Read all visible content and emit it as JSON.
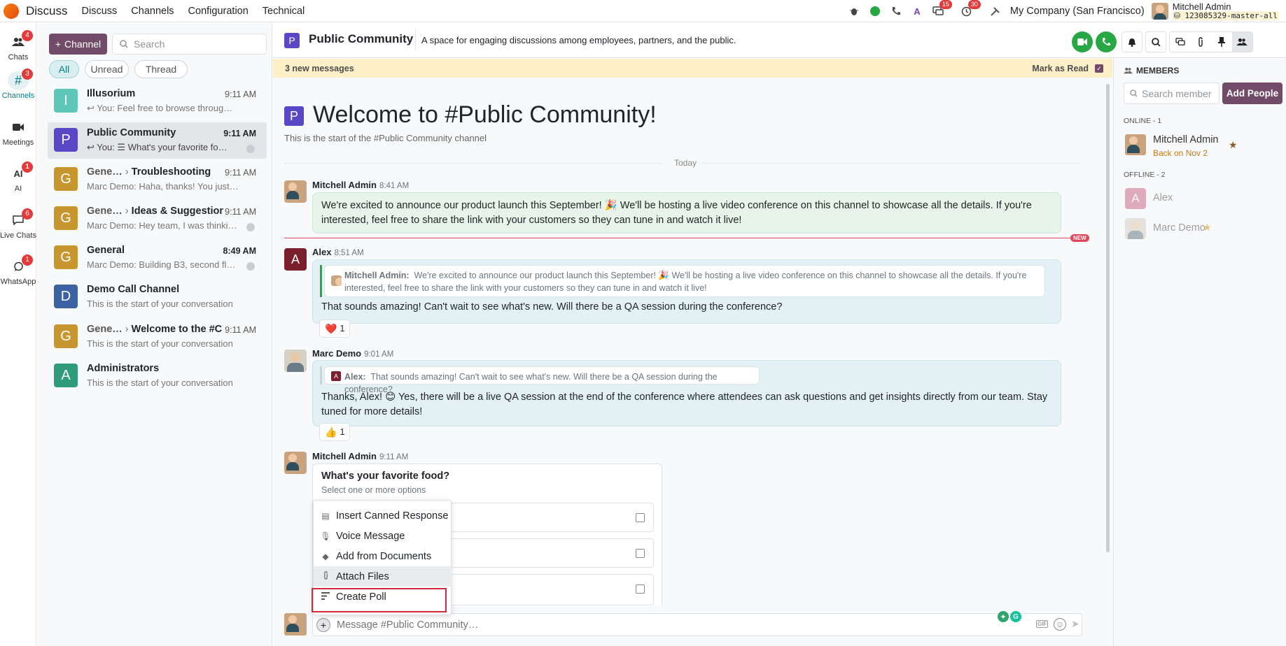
{
  "topbar": {
    "app_name": "Discuss",
    "menus": [
      "Discuss",
      "Channels",
      "Configuration",
      "Technical"
    ],
    "messages_badge": "15",
    "activity_badge": "30",
    "company": "My Company (San Francisco)",
    "user_name": "Mitchell Admin",
    "db_name": "123085329-master-all"
  },
  "rail": [
    {
      "label": "Chats",
      "badge": "4",
      "icon": "users-icon"
    },
    {
      "label": "Channels",
      "badge": "3",
      "icon": "hash-icon"
    },
    {
      "label": "Meetings",
      "badge": "",
      "icon": "video-icon"
    },
    {
      "label": "AI",
      "badge": "1",
      "icon": "ai-icon"
    },
    {
      "label": "Live Chats",
      "badge": "6",
      "icon": "chat-icon"
    },
    {
      "label": "WhatsApp",
      "badge": "1",
      "icon": "whatsapp-icon"
    }
  ],
  "sidebar": {
    "add_channel": "Channel",
    "search_placeholder": "Search",
    "filters": [
      "All",
      "Unread",
      "Thread"
    ],
    "conversations": [
      {
        "avatar": "I",
        "color": "#5fc7b8",
        "name": "Illusorium",
        "sub": "",
        "time": "9:11 AM",
        "preview": "↩ You: Feel free to browse throug…",
        "dot": false
      },
      {
        "avatar": "P",
        "color": "#5a47c5",
        "name": "Public Community",
        "sub": "",
        "time": "9:11 AM",
        "preview": "↩ You: ☰ What's your favorite fo…",
        "dot": true
      },
      {
        "avatar": "G",
        "color": "#c8962f",
        "name": "Gene…",
        "sub": "Troubleshooting",
        "time": "9:11 AM",
        "preview": "Marc Demo: Haha, thanks! You just…",
        "dot": false
      },
      {
        "avatar": "G",
        "color": "#c8962f",
        "name": "Gene…",
        "sub": "Ideas & Suggestions",
        "time": "9:11 AM",
        "preview": "Marc Demo: Hey team, I was thinki…",
        "dot": true
      },
      {
        "avatar": "G",
        "color": "#c8962f",
        "name": "General",
        "sub": "",
        "time": "8:49 AM",
        "preview": "Marc Demo: Building B3, second fl…",
        "dot": true
      },
      {
        "avatar": "D",
        "color": "#3b62a3",
        "name": "Demo Call Channel",
        "sub": "",
        "time": "",
        "preview": "This is the start of your conversation",
        "dot": false
      },
      {
        "avatar": "G",
        "color": "#c8962f",
        "name": "Gene…",
        "sub": "Welcome to the #C",
        "time": "9:11 AM",
        "preview": "This is the start of your conversation",
        "dot": false
      },
      {
        "avatar": "A",
        "color": "#2f9b7b",
        "name": "Administrators",
        "sub": "",
        "time": "",
        "preview": "This is the start of your conversation",
        "dot": false
      }
    ]
  },
  "header": {
    "channel_name": "Public Community",
    "description": "A space for engaging discussions among employees, partners, and the public."
  },
  "new_messages": {
    "text": "3 new messages",
    "mark_read": "Mark as Read"
  },
  "thread": {
    "welcome_title": "Welcome to #Public Community!",
    "welcome_sub": "This is the start of the #Public Community channel",
    "day_separator": "Today",
    "new_tag": "NEW",
    "messages": [
      {
        "author": "Mitchell Admin",
        "time": "8:41 AM",
        "text": "We're excited to announce our product launch this September! 🎉 We'll be hosting a live video conference on this channel to showcase all the details. If you're interested, feel free to share the link with your customers so they can tune in and watch it live!"
      },
      {
        "author": "Alex",
        "time": "8:51 AM",
        "quote_author": "Mitchell Admin:",
        "quote_text": "We're excited to announce our product launch this September! 🎉 We'll be hosting a live video conference on this channel to showcase all the details. If you're interested, feel free to share the link with your customers so they can tune in and watch it live!",
        "text": "That sounds amazing! Can't wait to see what's new. Will there be a QA session during the conference?",
        "reaction": "❤️",
        "reaction_count": "1"
      },
      {
        "author": "Marc Demo",
        "time": "9:01 AM",
        "quote_author": "Alex:",
        "quote_text": "That sounds amazing! Can't wait to see what's new. Will there be a QA session during the conference?",
        "text": "Thanks, Alex! 😊 Yes, there will be a live QA session at the end of the conference where attendees can ask questions and get insights directly from our team. Stay tuned for more details!",
        "reaction": "👍",
        "reaction_count": "1"
      },
      {
        "author": "Mitchell Admin",
        "time": "9:11 AM",
        "poll_question": "What's your favorite food?",
        "poll_hint": "Select one or more options"
      }
    ]
  },
  "attach_menu": [
    {
      "label": "Insert Canned Response",
      "icon": "canned-icon"
    },
    {
      "label": "Voice Message",
      "icon": "mic-icon"
    },
    {
      "label": "Add from Documents",
      "icon": "documents-icon"
    },
    {
      "label": "Attach Files",
      "icon": "paperclip-icon"
    },
    {
      "label": "Create Poll",
      "icon": "poll-icon"
    }
  ],
  "composer": {
    "placeholder": "Message #Public Community…"
  },
  "members": {
    "title": "MEMBERS",
    "search_placeholder": "Search member",
    "add_people": "Add People",
    "online_label": "ONLINE - 1",
    "offline_label": "OFFLINE - 2",
    "online": [
      {
        "name": "Mitchell Admin",
        "status": "Back on Nov 2"
      }
    ],
    "offline": [
      {
        "name": "Alex"
      },
      {
        "name": "Marc Demo"
      }
    ]
  }
}
